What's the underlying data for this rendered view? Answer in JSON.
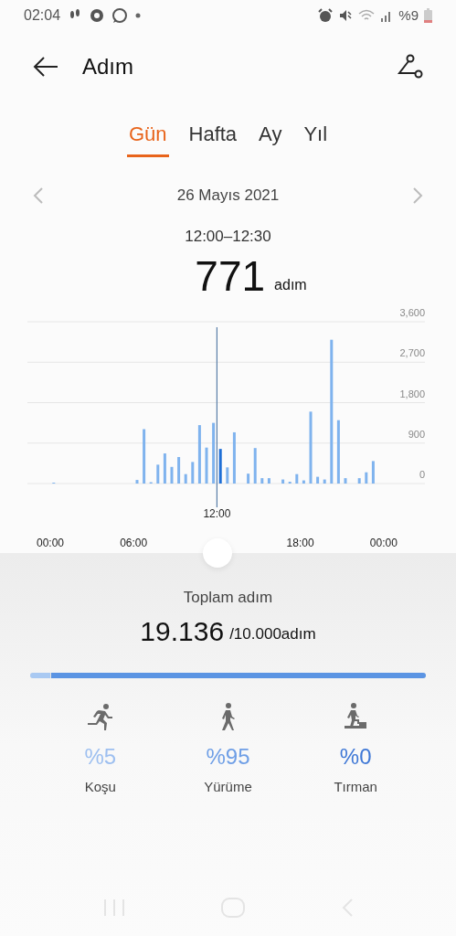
{
  "status_bar": {
    "time": "02:04",
    "battery": "%9"
  },
  "header": {
    "title": "Adım"
  },
  "tabs": [
    {
      "label": "Gün",
      "selected": true
    },
    {
      "label": "Hafta",
      "selected": false
    },
    {
      "label": "Ay",
      "selected": false
    },
    {
      "label": "Yıl",
      "selected": false
    }
  ],
  "date": "26 Mayıs 2021",
  "selection": {
    "range": "12:00–12:30",
    "value": "771",
    "unit": "adım"
  },
  "chart": {
    "chart_data": {
      "type": "bar",
      "stacked": true,
      "grid": true,
      "categories": [
        "00:00",
        null,
        null,
        null,
        null,
        null,
        null,
        null,
        null,
        null,
        null,
        null,
        "06:00",
        null,
        null,
        null,
        null,
        null,
        null,
        null,
        null,
        null,
        null,
        null,
        "12:00",
        null,
        null,
        null,
        null,
        null,
        null,
        null,
        null,
        null,
        null,
        null,
        "18:00",
        null,
        null,
        null,
        null,
        null,
        null,
        null,
        null,
        null,
        null,
        null,
        "00:00"
      ],
      "series": [
        {
          "color": "#7fb3ee",
          "values": [
            20,
            null,
            null,
            null,
            null,
            null,
            null,
            null,
            null,
            null,
            null,
            null,
            80,
            1210,
            30,
            420,
            670,
            370,
            590,
            210,
            480,
            1300,
            800,
            1350,
            null,
            360,
            1140,
            null,
            220,
            790,
            120,
            120,
            null,
            90,
            40,
            210,
            70,
            1600,
            150,
            90,
            3200,
            1410,
            120,
            null,
            120,
            250,
            500,
            null,
            null
          ]
        },
        {
          "color": "#1f6fd6",
          "values": [
            null,
            null,
            null,
            null,
            null,
            null,
            null,
            null,
            null,
            null,
            null,
            null,
            null,
            null,
            null,
            null,
            null,
            null,
            null,
            null,
            null,
            null,
            null,
            null,
            770,
            null,
            null,
            null,
            null,
            null,
            null,
            null,
            null,
            null,
            null,
            null,
            null,
            null,
            null,
            null,
            null,
            null,
            null,
            null,
            null,
            null,
            null,
            null,
            null
          ]
        }
      ],
      "ylim": [
        0,
        3600
      ],
      "yticks": [
        {
          "value": 0,
          "label": "0"
        },
        {
          "value": 900,
          "label": "900"
        },
        {
          "value": 1800,
          "label": "1,800"
        },
        {
          "value": 2700,
          "label": "2,700"
        },
        {
          "value": 3600,
          "label": "3,600"
        }
      ]
    }
  },
  "total": {
    "label": "Toplam adım",
    "value": "19.136",
    "goal": "/10.000adım"
  },
  "progress": [
    {
      "level": 0.05,
      "color": "#a9c9f2"
    },
    {
      "level": 0.95,
      "color": "#5b94e3"
    }
  ],
  "stats": [
    {
      "kind": "run",
      "value": "%5",
      "label": "Koşu",
      "color": "#9dbff0"
    },
    {
      "kind": "walk",
      "value": "%95",
      "label": "Yürüme",
      "color": "#6f9fe6"
    },
    {
      "kind": "climb",
      "value": "%0",
      "label": "Tırman",
      "color": "#3f78d6"
    }
  ]
}
